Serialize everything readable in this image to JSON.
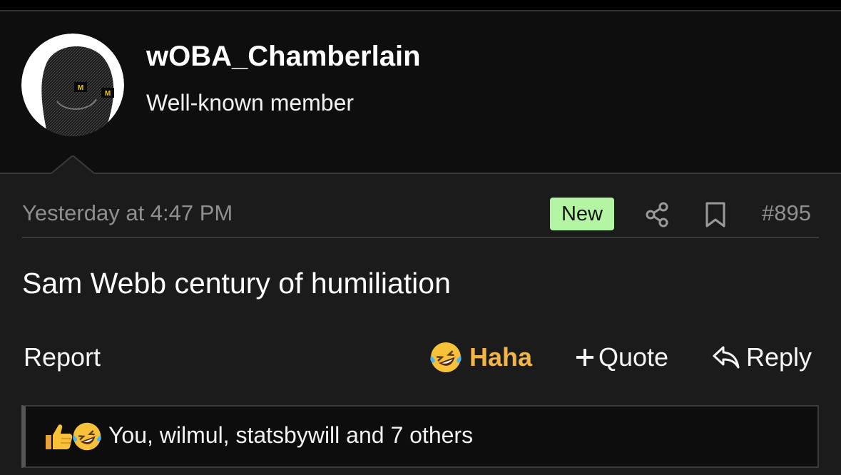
{
  "post": {
    "author": {
      "username": "wOBA_Chamberlain",
      "title": "Well-known member",
      "avatar_icon": "dark-face-avatar",
      "avatar_eye_glyph": "M"
    },
    "timestamp": "Yesterday at 4:47 PM",
    "badge": "New",
    "share_icon": "share-icon",
    "bookmark_icon": "bookmark-icon",
    "number": "#895",
    "body": "Sam Webb century of humiliation",
    "actions": {
      "report": "Report",
      "reaction_label": "Haha",
      "reaction_icon": "laughing-crying-emoji",
      "quote": "Quote",
      "quote_icon": "plus-icon",
      "reply": "Reply",
      "reply_icon": "reply-arrow-icon"
    },
    "reactions": {
      "icons": [
        "thumbs-up-emoji",
        "laughing-crying-emoji"
      ],
      "summary": "You, wilmul, statsbywill and 7 others"
    }
  },
  "colors": {
    "badge_bg": "#b3f5a3",
    "haha_accent": "#f2b347",
    "muted_text": "#8f8f8f",
    "header_bg": "#0e0e0e",
    "body_bg": "#1b1b1b"
  }
}
